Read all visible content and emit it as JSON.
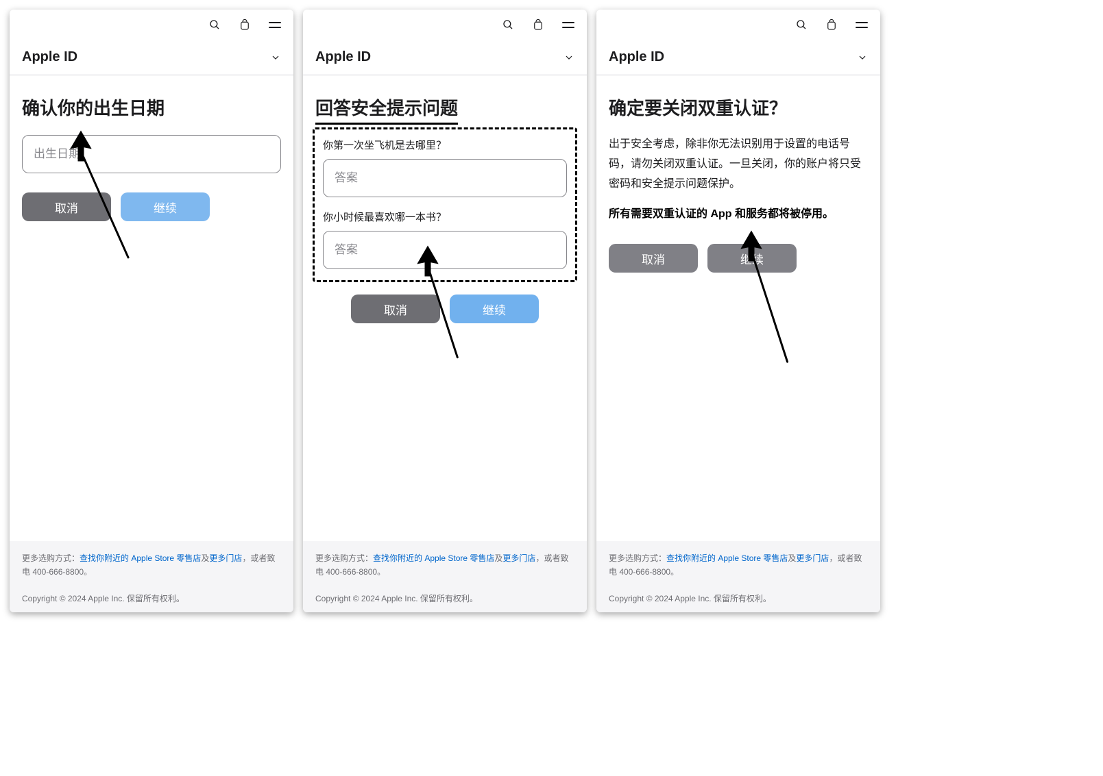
{
  "nav": {
    "brand_glyph": "",
    "subnav_title": "Apple ID"
  },
  "panel1": {
    "title": "确认你的出生日期",
    "birthday_placeholder": "出生日期",
    "cancel": "取消",
    "continue": "继续"
  },
  "panel2": {
    "title": "回答安全提示问题",
    "q1": "你第一次坐飞机是去哪里？",
    "q2": "你小时候最喜欢哪一本书？",
    "answer_placeholder": "答案",
    "cancel": "取消",
    "continue": "继续"
  },
  "panel3": {
    "title": "确定要关闭双重认证？",
    "body": "出于安全考虑，除非你无法识别用于设置的电话号码，请勿关闭双重认证。一旦关闭，你的账户将只受密码和安全提示问题保护。",
    "bold": "所有需要双重认证的 App 和服务都将被停用。",
    "cancel": "取消",
    "continue": "继续"
  },
  "footer": {
    "prefix": "更多选购方式：",
    "link1": "查找你附近的 Apple Store 零售店",
    "mid": "及",
    "link2": "更多门店",
    "suffix": "，或者致电 400-666-8800。",
    "copyright": "Copyright © 2024 Apple Inc. 保留所有权利。"
  }
}
